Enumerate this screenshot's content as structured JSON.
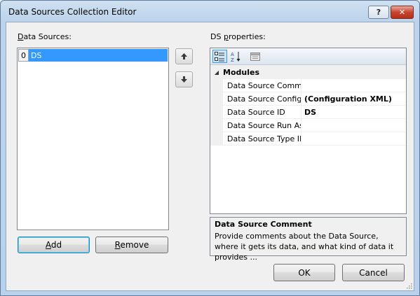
{
  "window": {
    "title": "Data Sources Collection Editor",
    "help_glyph": "?",
    "close_glyph": "✕"
  },
  "left": {
    "label_prefix": "",
    "label_access": "D",
    "label_rest": "ata Sources:",
    "items": [
      {
        "index": "0",
        "name": "DS",
        "selected": true
      }
    ],
    "move_up_icon": "arrow-up-icon",
    "move_down_icon": "arrow-down-icon",
    "add_access": "A",
    "add_rest": "dd",
    "remove_access": "R",
    "remove_rest": "emove"
  },
  "properties": {
    "label_prefix": "DS ",
    "label_access": "p",
    "label_rest": "roperties:",
    "toolbar": {
      "categorized_icon": "categorized-icon",
      "alphabetical_icon": "alphabetical-icon",
      "property_pages_icon": "property-pages-icon"
    },
    "category": "Modules",
    "rows": [
      {
        "name": "Data Source Comme",
        "value": ""
      },
      {
        "name": "Data Source Configu",
        "value": "(Configuration XML)"
      },
      {
        "name": "Data Source ID",
        "value": "DS"
      },
      {
        "name": "Data Source Run As",
        "value": ""
      },
      {
        "name": "Data Source Type ID",
        "value": ""
      }
    ],
    "description": {
      "title": "Data Source Comment",
      "text": "Provide comments about the Data Source, where it gets its data, and what kind of data it provides ..."
    }
  },
  "footer": {
    "ok_label": "OK",
    "cancel_label": "Cancel"
  },
  "colors": {
    "selection": "#3399ff",
    "close_button": "#c6452f"
  }
}
